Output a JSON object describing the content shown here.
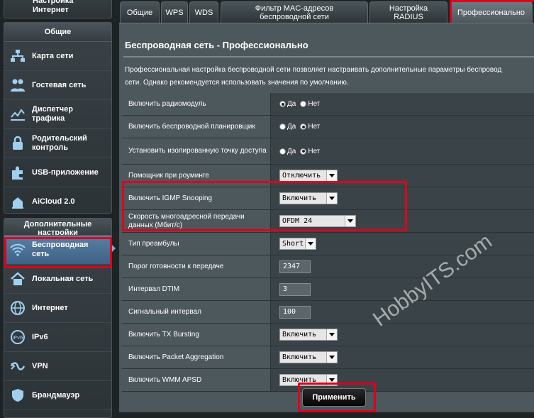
{
  "sidebar": {
    "top_item": "Настройка\nИнтернет",
    "general_header": "Общие",
    "general_items": [
      {
        "label": "Карта сети",
        "icon": "network-map-icon"
      },
      {
        "label": "Гостевая сеть",
        "icon": "guest-network-icon"
      },
      {
        "label": "Диспетчер\nтрафика",
        "icon": "traffic-manager-icon"
      },
      {
        "label": "Родительский\nконтроль",
        "icon": "parental-control-icon"
      },
      {
        "label": "USB-приложение",
        "icon": "usb-app-icon"
      },
      {
        "label": "AiCloud 2.0",
        "icon": "aicloud-icon"
      }
    ],
    "advanced_header": "Дополнительные\nнастройки",
    "advanced_items": [
      {
        "label": "Беспроводная\nсеть",
        "icon": "wireless-icon"
      },
      {
        "label": "Локальная сеть",
        "icon": "lan-icon"
      },
      {
        "label": "Интернет",
        "icon": "internet-globe-icon"
      },
      {
        "label": "IPv6",
        "icon": "ipv6-icon"
      },
      {
        "label": "VPN",
        "icon": "vpn-icon"
      },
      {
        "label": "Брандмауэр",
        "icon": "firewall-icon"
      }
    ]
  },
  "tabs": [
    {
      "label": "Общие"
    },
    {
      "label": "WPS"
    },
    {
      "label": "WDS"
    },
    {
      "label": "Фильтр MAC-адресов\nбеспроводной сети"
    },
    {
      "label": "Настройка\nRADIUS"
    },
    {
      "label": "Профессионально"
    }
  ],
  "page": {
    "title": "Беспроводная сеть - Профессионально",
    "desc_line1": "Профессиональная настройка беспроводной сети позволяет настраивать дополнительные параметры беспровод",
    "desc_line2": "сети. Однако рекомендуется использовать значения по умолчанию."
  },
  "radio_labels": {
    "yes": "Да",
    "no": "Нет"
  },
  "settings": [
    {
      "label": "Включить радиомодуль",
      "type": "radio",
      "value": "yes"
    },
    {
      "label": "Включить беспроводной планировщик",
      "type": "radio",
      "value": "no"
    },
    {
      "label": "Установить изолированную точку доступа",
      "type": "radio",
      "value": "no"
    },
    {
      "label": "Помощник при роуминге",
      "type": "select",
      "value": "Отключить"
    },
    {
      "label": "Включить IGMP Snooping",
      "type": "select",
      "value": "Включить"
    },
    {
      "label": "Скорость многоадресной передачи данных (Мбит/с)",
      "type": "select",
      "value": "OFDM 24"
    },
    {
      "label": "Тип преамбулы",
      "type": "select",
      "value": "Short"
    },
    {
      "label": "Порог готовности к передаче",
      "type": "input",
      "value": "2347"
    },
    {
      "label": "Интервал DTIM",
      "type": "input",
      "value": "3"
    },
    {
      "label": "Сигнальный интервал",
      "type": "input",
      "value": "100"
    },
    {
      "label": "Включить TX Bursting",
      "type": "select",
      "value": "Включить"
    },
    {
      "label": "Включить Packet Aggregation",
      "type": "select",
      "value": "Включить"
    },
    {
      "label": "Включить WMM APSD",
      "type": "select",
      "value": "Включить"
    }
  ],
  "apply_label": "Применить",
  "watermark": "HobbyITS.com",
  "colors": {
    "highlight": "#e0001b",
    "active_nav": "#4f7396",
    "content_bg": "#4d585d"
  }
}
